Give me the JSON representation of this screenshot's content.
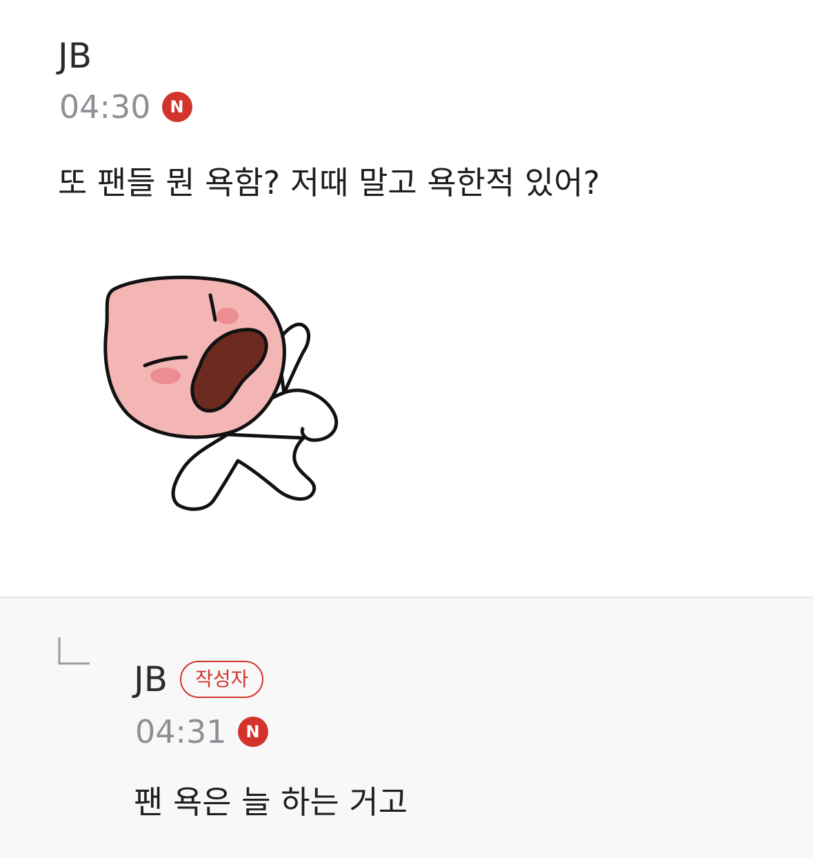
{
  "comment": {
    "author": "JB",
    "time": "04:30",
    "new_badge": "N",
    "text": "또 팬들 뭔 욕함? 저때 말고 욕한적 있어?",
    "sticker": "peach-character-shouting"
  },
  "reply": {
    "author": "JB",
    "writer_badge": "작성자",
    "time": "04:31",
    "new_badge": "N",
    "text": "팬 욕은 늘 하는 거고"
  },
  "colors": {
    "badge_red": "#d2342c",
    "time_gray": "#8e8e95",
    "reply_bg": "#f8f8f9"
  }
}
